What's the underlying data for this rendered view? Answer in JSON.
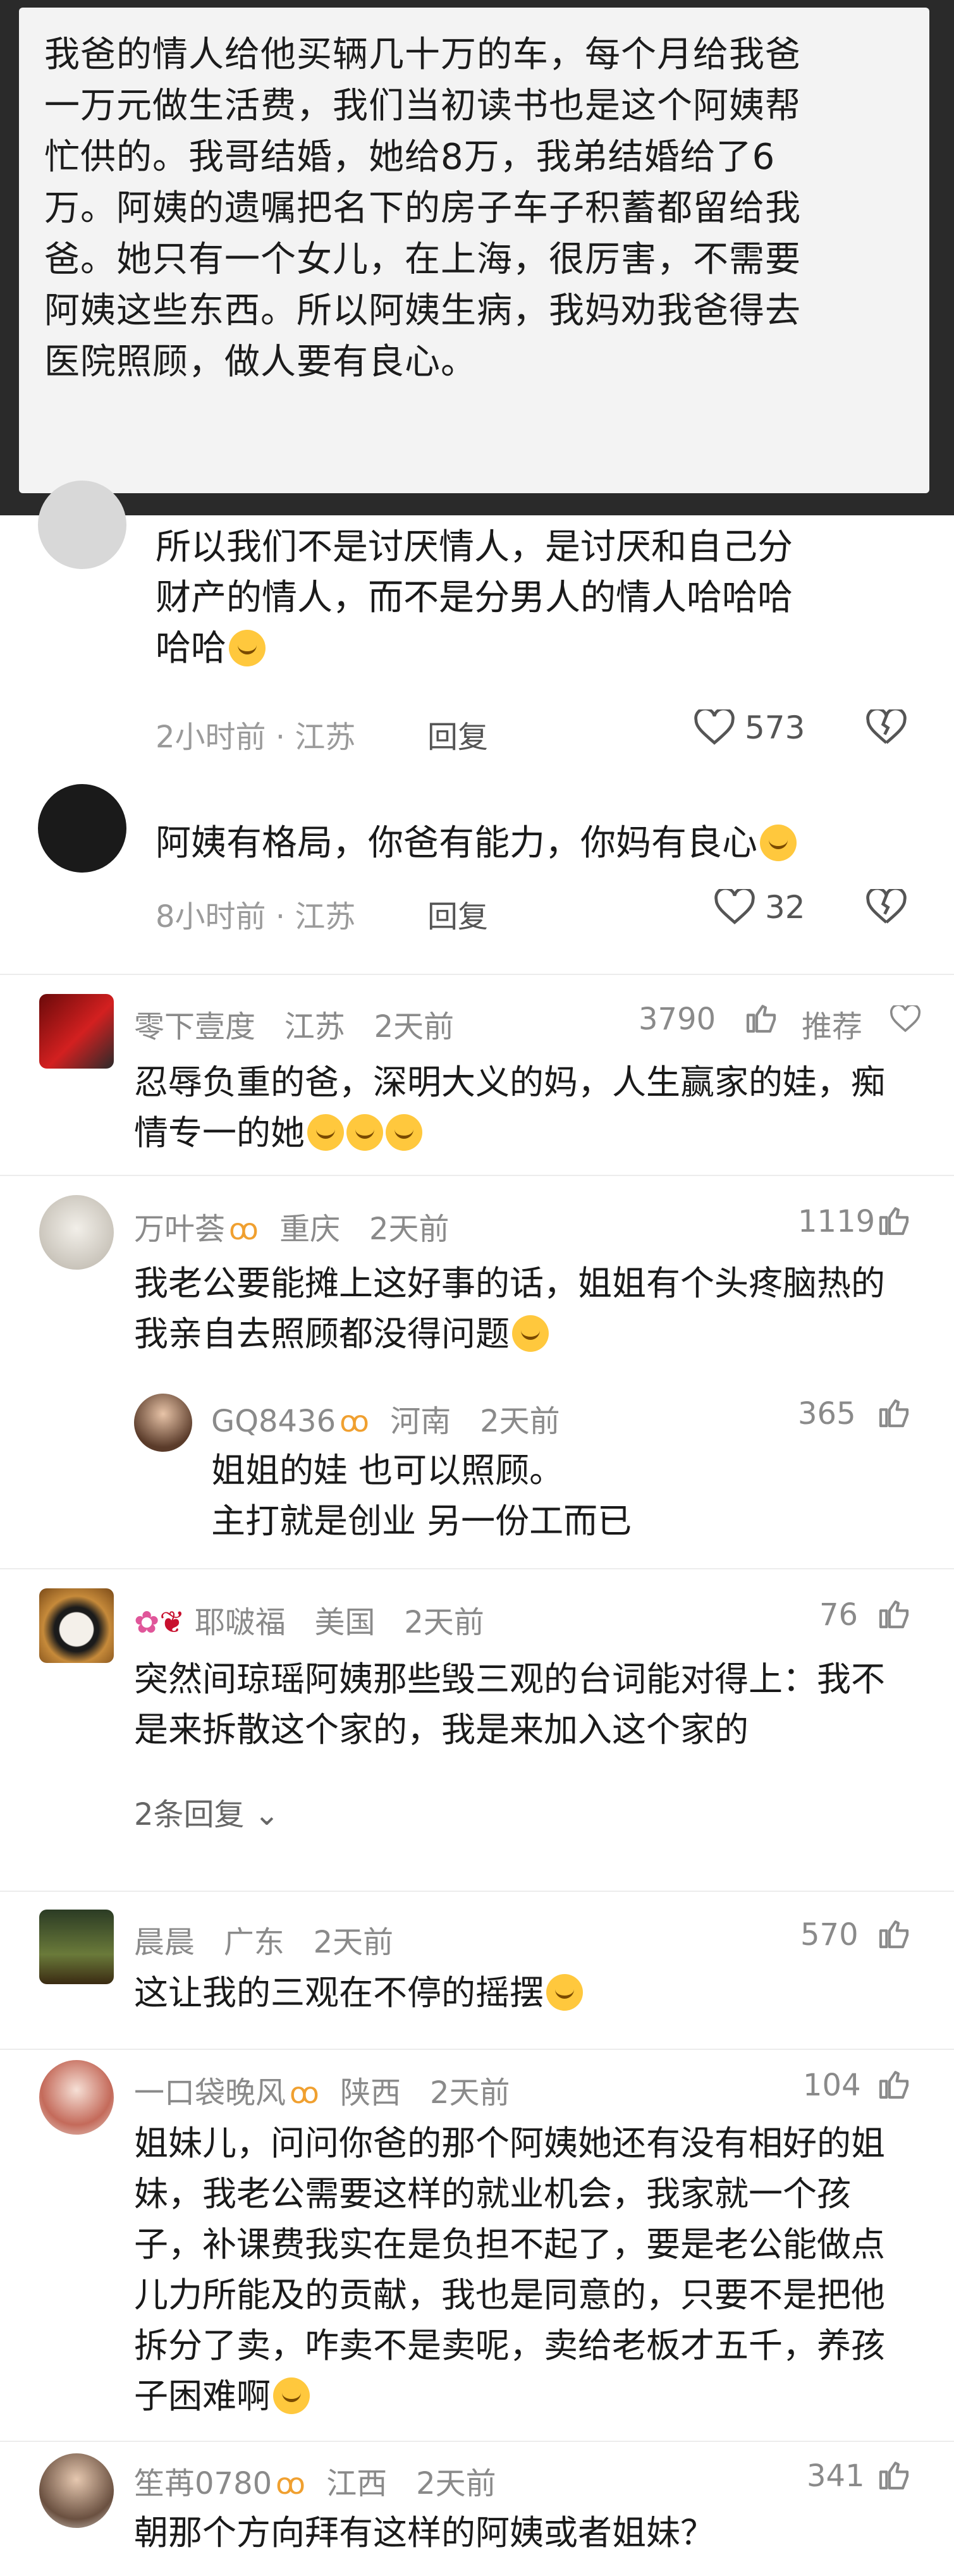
{
  "post": {
    "lines": [
      "我爸的情人给他买辆几十万的车，每个月给我爸",
      "一万元做生活费，我们当初读书也是这个阿姨帮",
      "忙供的。我哥结婚，她给8万，我弟结婚给了6",
      "万。阿姨的遗嘱把名下的房子车子积蓄都留给我",
      "爸。她只有一个女儿，在上海，很厉害，不需要",
      "阿姨这些东西。所以阿姨生病，我妈劝我爸得去",
      "医院照顾，做人要有良心。"
    ]
  },
  "thread": [
    {
      "lines": [
        "所以我们不是讨厌情人，是讨厌和自己分",
        "财产的情人，而不是分男人的情人哈哈哈",
        "哈哈"
      ],
      "meta": "2小时前 · 江苏",
      "reply": "回复",
      "likes": "573"
    },
    {
      "lines": [
        "阿姨有格局，你爸有能力，你妈有良心"
      ],
      "meta": "8小时前 · 江苏",
      "reply": "回复",
      "likes": "32"
    }
  ],
  "comments": [
    {
      "name": "零下壹度",
      "location": "江苏",
      "time": "2天前",
      "count": "3790",
      "extra": "推荐",
      "lines": [
        "忍辱负重的爸，深明大义的妈，人生赢家的娃，痴",
        "情专一的她"
      ]
    },
    {
      "name": "万叶荟",
      "location": "重庆",
      "time": "2天前",
      "count": "1119",
      "lines": [
        "我老公要能摊上这好事的话，姐姐有个头疼脑热的",
        "我亲自去照顾都没得问题"
      ]
    },
    {
      "name": "GQ8436",
      "location": "河南",
      "time": "2天前",
      "count": "365",
      "lines": [
        "姐姐的娃 也可以照顾。",
        "主打就是创业 另一份工而已"
      ]
    },
    {
      "name": "耶啵福",
      "location": "美国",
      "time": "2天前",
      "count": "76",
      "lines": [
        "突然间琼瑶阿姨那些毁三观的台词能对得上：我不",
        "是来拆散这个家的，我是来加入这个家的"
      ],
      "more": "2条回复"
    },
    {
      "name": "晨晨",
      "location": "广东",
      "time": "2天前",
      "count": "570",
      "lines": [
        "这让我的三观在不停的摇摆"
      ]
    },
    {
      "name": "一口袋晚风",
      "location": "陕西",
      "time": "2天前",
      "count": "104",
      "lines": [
        "姐妹儿，问问你爸的那个阿姨她还有没有相好的姐",
        "妹，我老公需要这样的就业机会，我家就一个孩",
        "子，补课费我实在是负担不起了，要是老公能做点",
        "儿力所能及的贡献，我也是同意的，只要不是把他",
        "拆分了卖，咋卖不是卖呢，卖给老板才五千，养孩",
        "子困难啊"
      ]
    },
    {
      "name": "笙苒0780",
      "location": "江西",
      "time": "2天前",
      "count": "341",
      "lines": [
        "朝那个方向拜有这样的阿姨或者姐妹？"
      ]
    }
  ],
  "colors": {
    "accent_vip": "#f0a030",
    "meta": "#9a9a9a",
    "body": "#1a1a1a"
  }
}
